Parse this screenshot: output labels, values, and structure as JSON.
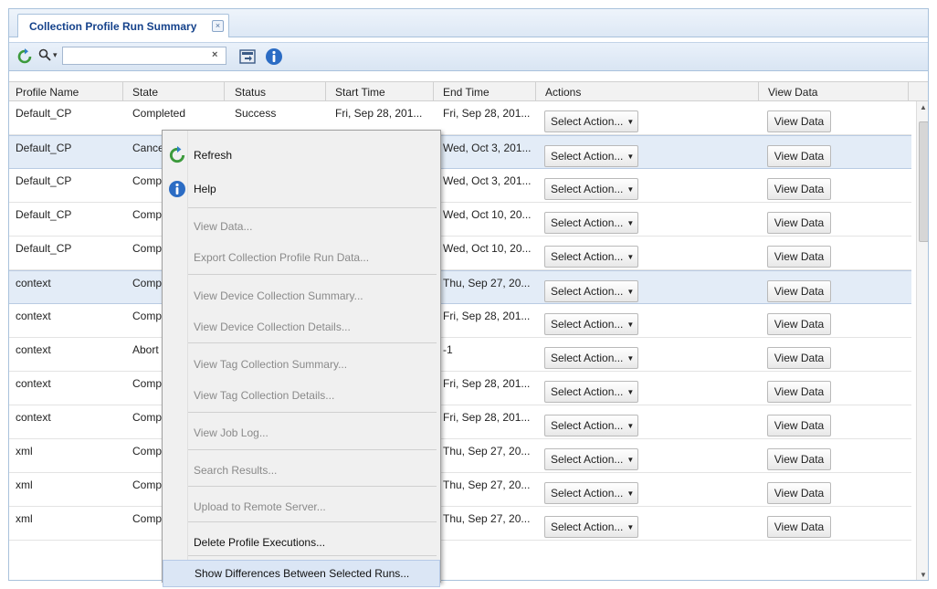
{
  "tab": {
    "title": "Collection Profile Run Summary",
    "close_glyph": "×"
  },
  "toolbar": {
    "search_value": "",
    "search_clear": "×",
    "search_caret": "▾"
  },
  "columns": [
    "Profile Name",
    "State",
    "Status",
    "Start Time",
    "End Time",
    "Actions",
    "View Data"
  ],
  "rows": [
    {
      "profile": "Default_CP",
      "state": "Completed",
      "status": "Success",
      "start": "Fri, Sep 28, 201...",
      "end": "Fri, Sep 28, 201...",
      "action": "Select Action...",
      "view": "View Data",
      "selected": false
    },
    {
      "profile": "Default_CP",
      "state": "Cance",
      "status": "",
      "start": "",
      "end": "Wed, Oct 3, 201...",
      "action": "Select Action...",
      "view": "View Data",
      "selected": true
    },
    {
      "profile": "Default_CP",
      "state": "Compl",
      "status": "",
      "start": "",
      "end": "Wed, Oct 3, 201...",
      "action": "Select Action...",
      "view": "View Data",
      "selected": false
    },
    {
      "profile": "Default_CP",
      "state": "Compl",
      "status": "",
      "start": "",
      "end": "Wed, Oct 10, 20...",
      "action": "Select Action...",
      "view": "View Data",
      "selected": false
    },
    {
      "profile": "Default_CP",
      "state": "Compl",
      "status": "",
      "start": "",
      "end": "Wed, Oct 10, 20...",
      "action": "Select Action...",
      "view": "View Data",
      "selected": false
    },
    {
      "profile": "context",
      "state": "Compl",
      "status": "",
      "start": "",
      "end": "Thu, Sep 27, 20...",
      "action": "Select Action...",
      "view": "View Data",
      "selected": true
    },
    {
      "profile": "context",
      "state": "Compl",
      "status": "",
      "start": "",
      "end": "Fri, Sep 28, 201...",
      "action": "Select Action...",
      "view": "View Data",
      "selected": false
    },
    {
      "profile": "context",
      "state": "Abort",
      "status": "",
      "start": "",
      "end": "-1",
      "action": "Select Action...",
      "view": "View Data",
      "selected": false
    },
    {
      "profile": "context",
      "state": "Compl",
      "status": "",
      "start": "",
      "end": "Fri, Sep 28, 201...",
      "action": "Select Action...",
      "view": "View Data",
      "selected": false
    },
    {
      "profile": "context",
      "state": "Compl",
      "status": "",
      "start": "",
      "end": "Fri, Sep 28, 201...",
      "action": "Select Action...",
      "view": "View Data",
      "selected": false
    },
    {
      "profile": "xml",
      "state": "Compl",
      "status": "",
      "start": "",
      "end": "Thu, Sep 27, 20...",
      "action": "Select Action...",
      "view": "View Data",
      "selected": false
    },
    {
      "profile": "xml",
      "state": "Compl",
      "status": "",
      "start": "",
      "end": "Thu, Sep 27, 20...",
      "action": "Select Action...",
      "view": "View Data",
      "selected": false
    },
    {
      "profile": "xml",
      "state": "Compl",
      "status": "",
      "start": "",
      "end": "Thu, Sep 27, 20...",
      "action": "Select Action...",
      "view": "View Data",
      "selected": false
    }
  ],
  "context_menu": {
    "items": [
      {
        "label": "Refresh",
        "enabled": true,
        "icon": "refresh-icon"
      },
      {
        "label": "Help",
        "enabled": true,
        "icon": "info-icon"
      },
      {
        "label": "View Data...",
        "enabled": false
      },
      {
        "label": "Export Collection Profile Run Data...",
        "enabled": false
      },
      {
        "label": "View Device Collection Summary...",
        "enabled": false
      },
      {
        "label": "View Device Collection Details...",
        "enabled": false
      },
      {
        "label": "View Tag Collection Summary...",
        "enabled": false
      },
      {
        "label": "View Tag Collection Details...",
        "enabled": false
      },
      {
        "label": "View Job Log...",
        "enabled": false
      },
      {
        "label": "Search Results...",
        "enabled": false
      },
      {
        "label": "Upload to Remote Server...",
        "enabled": false
      },
      {
        "label": "Delete Profile Executions...",
        "enabled": true
      },
      {
        "label": "Show Differences Between Selected Runs...",
        "enabled": true,
        "hover": true
      }
    ]
  },
  "colors": {
    "accent": "#15428b",
    "selected_row": "#e3ecf7",
    "menu_bg": "#f0f0f0",
    "disabled_text": "#8a8a8a"
  }
}
